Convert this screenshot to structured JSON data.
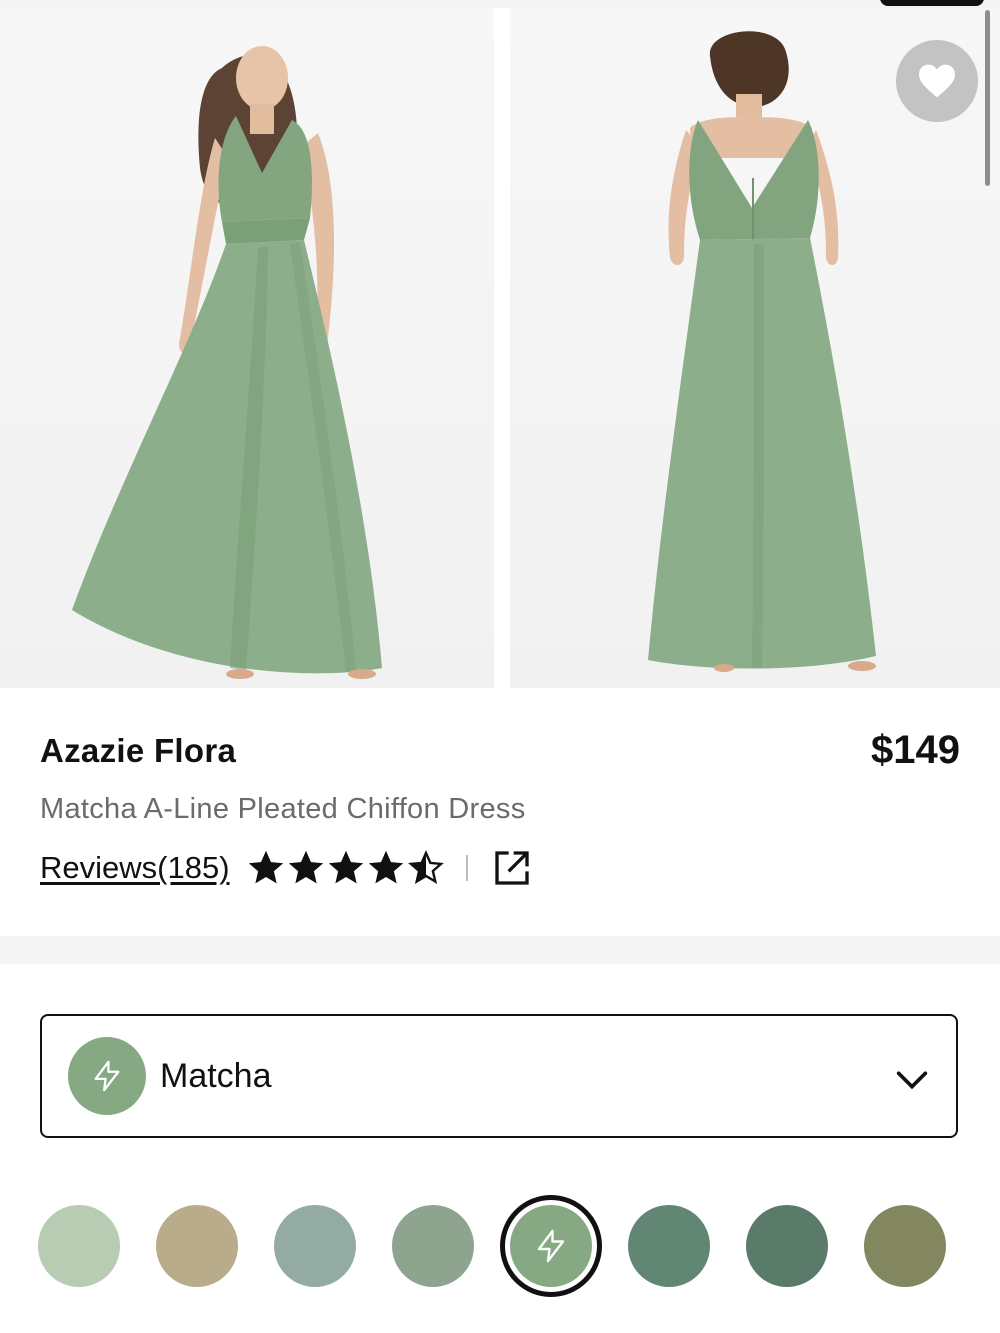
{
  "product": {
    "brand": "Azazie Flora",
    "price": "$149",
    "name": "Matcha A-Line Pleated Chiffon Dress",
    "reviews_label": "Reviews(185)",
    "rating": 4.5,
    "rating_max": 5
  },
  "color_select": {
    "selected_label": "Matcha",
    "selected_color": "#86a883"
  },
  "swatches": [
    {
      "color": "#b7ccb2",
      "selected": false,
      "icon": ""
    },
    {
      "color": "#b8ac8b",
      "selected": false,
      "icon": ""
    },
    {
      "color": "#94aba3",
      "selected": false,
      "icon": ""
    },
    {
      "color": "#8ea48f",
      "selected": false,
      "icon": ""
    },
    {
      "color": "#86a883",
      "selected": true,
      "icon": "lightning-icon"
    },
    {
      "color": "#618674",
      "selected": false,
      "icon": ""
    },
    {
      "color": "#5a7b69",
      "selected": false,
      "icon": ""
    },
    {
      "color": "#828760",
      "selected": false,
      "icon": ""
    }
  ],
  "colors": {
    "dress": "#8cae8a",
    "dress_shadow": "#749a72",
    "text": "#111111",
    "muted_text": "#6b6b6b"
  },
  "icons": {
    "wishlist": "heart-icon",
    "share": "external-link-icon",
    "dropdown": "chevron-down-icon",
    "fast_ship": "lightning-icon"
  }
}
